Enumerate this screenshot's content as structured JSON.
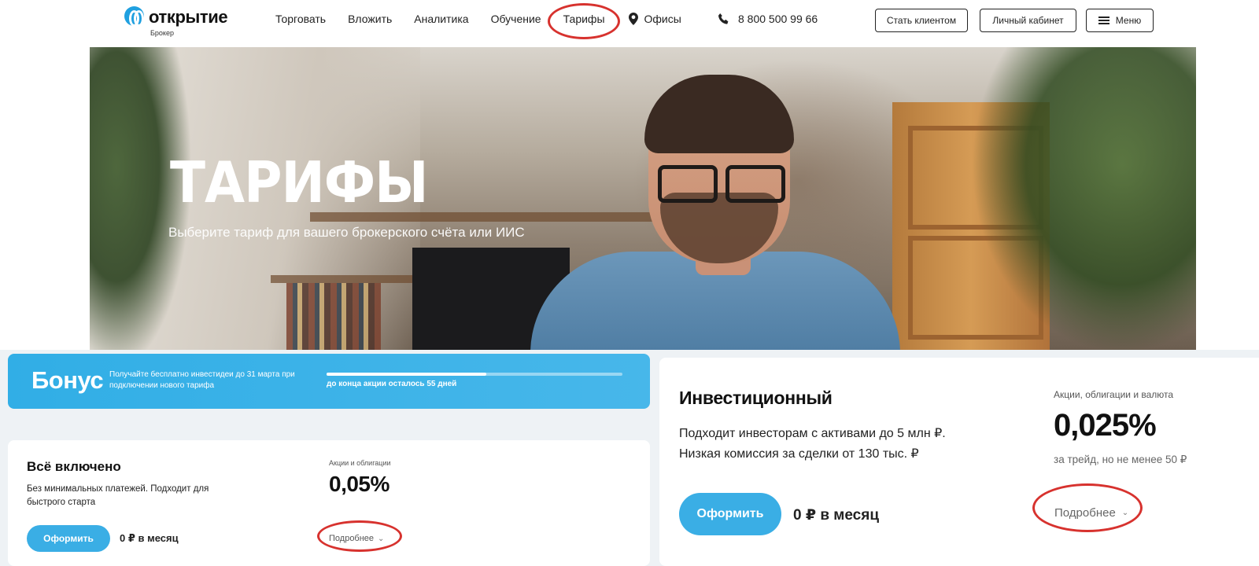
{
  "header": {
    "logo_text": "открытие",
    "logo_sub": "Брокер",
    "nav": [
      {
        "label": "Торговать"
      },
      {
        "label": "Вложить"
      },
      {
        "label": "Аналитика"
      },
      {
        "label": "Обучение"
      },
      {
        "label": "Тарифы",
        "active": true
      },
      {
        "label": "Офисы",
        "icon": "pin-icon"
      }
    ],
    "phone": "8 800 500 99 66",
    "phone_icon": "phone-icon",
    "buttons": {
      "become_client": "Стать клиентом",
      "cabinet": "Личный кабинет",
      "menu": "Меню"
    }
  },
  "hero": {
    "title": "ТАРИФЫ",
    "subtitle": "Выберите тариф для вашего брокерского счёта или ИИС"
  },
  "bonus": {
    "title": "Бонус",
    "text": "Получайте бесплатно инвестидеи до 31 марта при подключении нового тарифа",
    "progress": 0.54,
    "remaining": "до конца акции осталось 55 дней"
  },
  "tariff_all_inclusive": {
    "title": "Всё включено",
    "description": "Без минимальных платежей. Подходит для быстрого старта",
    "caption": "Акции и облигации",
    "rate": "0,05%",
    "button": "Оформить",
    "price": "0 ₽ в месяц",
    "more": "Подробнее"
  },
  "tariff_investment": {
    "title": "Инвестиционный",
    "description_line1": "Подходит инвесторам с активами до 5 млн ₽.",
    "description_line2": "Низкая комиссия за сделки от 130 тыс. ₽",
    "caption": "Акции, облигации и валюта",
    "rate": "0,025%",
    "rate_note": "за трейд, но не менее 50 ₽",
    "button": "Оформить",
    "price": "0 ₽ в месяц",
    "more": "Подробнее"
  },
  "colors": {
    "accent": "#3aaee5",
    "highlight_ring": "#d7322e",
    "lower_bg": "#eef2f5"
  }
}
